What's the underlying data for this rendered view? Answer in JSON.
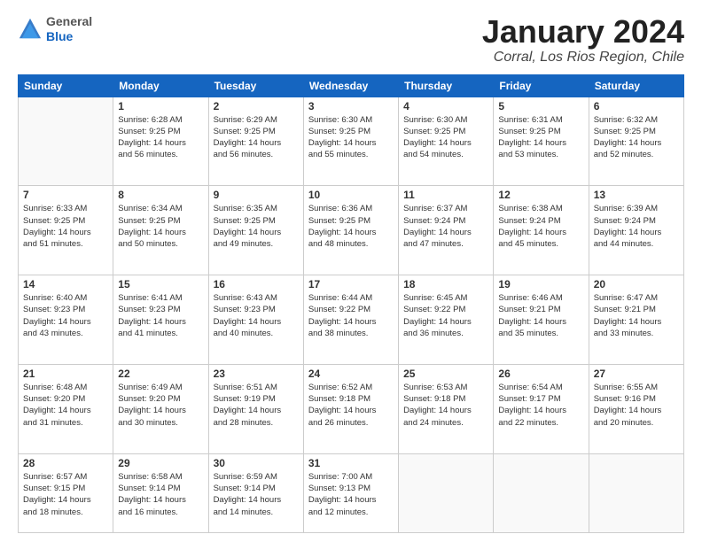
{
  "logo": {
    "general": "General",
    "blue": "Blue"
  },
  "title": {
    "month": "January 2024",
    "location": "Corral, Los Rios Region, Chile"
  },
  "headers": [
    "Sunday",
    "Monday",
    "Tuesday",
    "Wednesday",
    "Thursday",
    "Friday",
    "Saturday"
  ],
  "weeks": [
    [
      {
        "num": "",
        "info": ""
      },
      {
        "num": "1",
        "info": "Sunrise: 6:28 AM\nSunset: 9:25 PM\nDaylight: 14 hours\nand 56 minutes."
      },
      {
        "num": "2",
        "info": "Sunrise: 6:29 AM\nSunset: 9:25 PM\nDaylight: 14 hours\nand 56 minutes."
      },
      {
        "num": "3",
        "info": "Sunrise: 6:30 AM\nSunset: 9:25 PM\nDaylight: 14 hours\nand 55 minutes."
      },
      {
        "num": "4",
        "info": "Sunrise: 6:30 AM\nSunset: 9:25 PM\nDaylight: 14 hours\nand 54 minutes."
      },
      {
        "num": "5",
        "info": "Sunrise: 6:31 AM\nSunset: 9:25 PM\nDaylight: 14 hours\nand 53 minutes."
      },
      {
        "num": "6",
        "info": "Sunrise: 6:32 AM\nSunset: 9:25 PM\nDaylight: 14 hours\nand 52 minutes."
      }
    ],
    [
      {
        "num": "7",
        "info": "Sunrise: 6:33 AM\nSunset: 9:25 PM\nDaylight: 14 hours\nand 51 minutes."
      },
      {
        "num": "8",
        "info": "Sunrise: 6:34 AM\nSunset: 9:25 PM\nDaylight: 14 hours\nand 50 minutes."
      },
      {
        "num": "9",
        "info": "Sunrise: 6:35 AM\nSunset: 9:25 PM\nDaylight: 14 hours\nand 49 minutes."
      },
      {
        "num": "10",
        "info": "Sunrise: 6:36 AM\nSunset: 9:25 PM\nDaylight: 14 hours\nand 48 minutes."
      },
      {
        "num": "11",
        "info": "Sunrise: 6:37 AM\nSunset: 9:24 PM\nDaylight: 14 hours\nand 47 minutes."
      },
      {
        "num": "12",
        "info": "Sunrise: 6:38 AM\nSunset: 9:24 PM\nDaylight: 14 hours\nand 45 minutes."
      },
      {
        "num": "13",
        "info": "Sunrise: 6:39 AM\nSunset: 9:24 PM\nDaylight: 14 hours\nand 44 minutes."
      }
    ],
    [
      {
        "num": "14",
        "info": "Sunrise: 6:40 AM\nSunset: 9:23 PM\nDaylight: 14 hours\nand 43 minutes."
      },
      {
        "num": "15",
        "info": "Sunrise: 6:41 AM\nSunset: 9:23 PM\nDaylight: 14 hours\nand 41 minutes."
      },
      {
        "num": "16",
        "info": "Sunrise: 6:43 AM\nSunset: 9:23 PM\nDaylight: 14 hours\nand 40 minutes."
      },
      {
        "num": "17",
        "info": "Sunrise: 6:44 AM\nSunset: 9:22 PM\nDaylight: 14 hours\nand 38 minutes."
      },
      {
        "num": "18",
        "info": "Sunrise: 6:45 AM\nSunset: 9:22 PM\nDaylight: 14 hours\nand 36 minutes."
      },
      {
        "num": "19",
        "info": "Sunrise: 6:46 AM\nSunset: 9:21 PM\nDaylight: 14 hours\nand 35 minutes."
      },
      {
        "num": "20",
        "info": "Sunrise: 6:47 AM\nSunset: 9:21 PM\nDaylight: 14 hours\nand 33 minutes."
      }
    ],
    [
      {
        "num": "21",
        "info": "Sunrise: 6:48 AM\nSunset: 9:20 PM\nDaylight: 14 hours\nand 31 minutes."
      },
      {
        "num": "22",
        "info": "Sunrise: 6:49 AM\nSunset: 9:20 PM\nDaylight: 14 hours\nand 30 minutes."
      },
      {
        "num": "23",
        "info": "Sunrise: 6:51 AM\nSunset: 9:19 PM\nDaylight: 14 hours\nand 28 minutes."
      },
      {
        "num": "24",
        "info": "Sunrise: 6:52 AM\nSunset: 9:18 PM\nDaylight: 14 hours\nand 26 minutes."
      },
      {
        "num": "25",
        "info": "Sunrise: 6:53 AM\nSunset: 9:18 PM\nDaylight: 14 hours\nand 24 minutes."
      },
      {
        "num": "26",
        "info": "Sunrise: 6:54 AM\nSunset: 9:17 PM\nDaylight: 14 hours\nand 22 minutes."
      },
      {
        "num": "27",
        "info": "Sunrise: 6:55 AM\nSunset: 9:16 PM\nDaylight: 14 hours\nand 20 minutes."
      }
    ],
    [
      {
        "num": "28",
        "info": "Sunrise: 6:57 AM\nSunset: 9:15 PM\nDaylight: 14 hours\nand 18 minutes."
      },
      {
        "num": "29",
        "info": "Sunrise: 6:58 AM\nSunset: 9:14 PM\nDaylight: 14 hours\nand 16 minutes."
      },
      {
        "num": "30",
        "info": "Sunrise: 6:59 AM\nSunset: 9:14 PM\nDaylight: 14 hours\nand 14 minutes."
      },
      {
        "num": "31",
        "info": "Sunrise: 7:00 AM\nSunset: 9:13 PM\nDaylight: 14 hours\nand 12 minutes."
      },
      {
        "num": "",
        "info": ""
      },
      {
        "num": "",
        "info": ""
      },
      {
        "num": "",
        "info": ""
      }
    ]
  ]
}
